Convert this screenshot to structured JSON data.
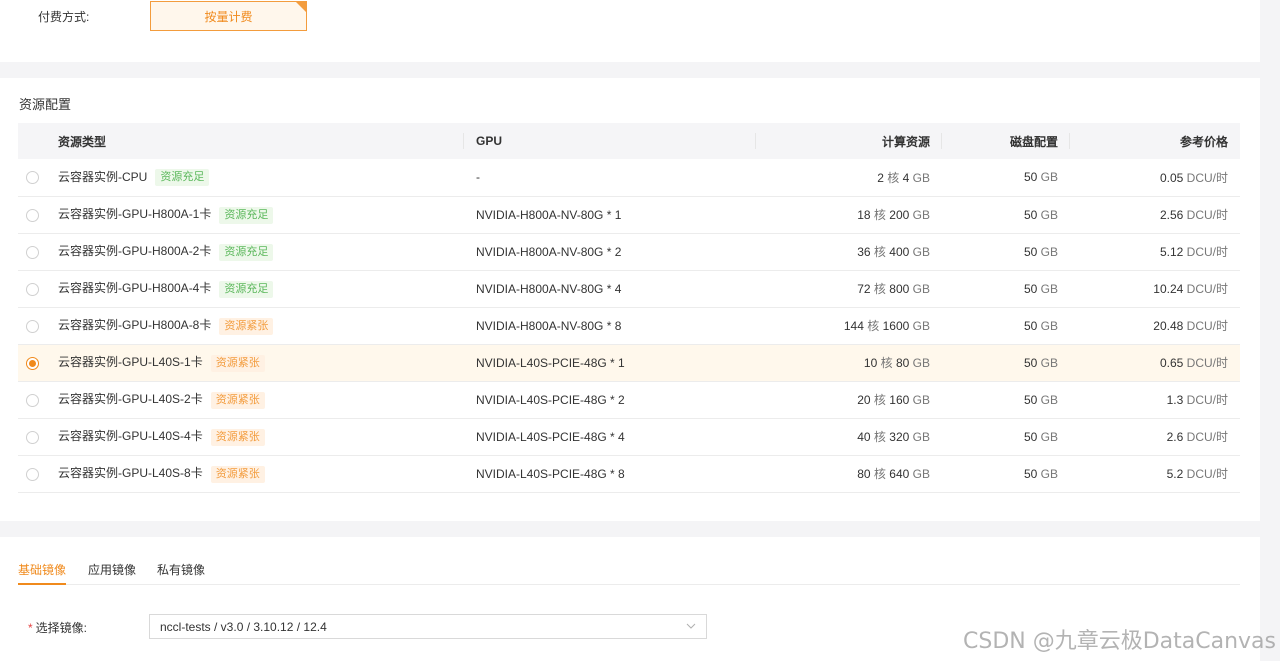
{
  "billing": {
    "label": "付费方式:",
    "option_label": "按量计费"
  },
  "resources": {
    "title": "资源配置",
    "columns": [
      "资源类型",
      "GPU",
      "计算资源",
      "磁盘配置",
      "参考价格"
    ],
    "rows": [
      {
        "name": "云容器实例-CPU",
        "tag": "资源充足",
        "tag_type": "ok",
        "gpu": "-",
        "cores": "2",
        "core_unit": "核",
        "mem": "4",
        "mem_unit": "GB",
        "disk": "50",
        "disk_unit": "GB",
        "price": "0.05",
        "price_unit": "DCU/时",
        "selected": false
      },
      {
        "name": "云容器实例-GPU-H800A-1卡",
        "tag": "资源充足",
        "tag_type": "ok",
        "gpu": "NVIDIA-H800A-NV-80G * 1",
        "cores": "18",
        "core_unit": "核",
        "mem": "200",
        "mem_unit": "GB",
        "disk": "50",
        "disk_unit": "GB",
        "price": "2.56",
        "price_unit": "DCU/时",
        "selected": false
      },
      {
        "name": "云容器实例-GPU-H800A-2卡",
        "tag": "资源充足",
        "tag_type": "ok",
        "gpu": "NVIDIA-H800A-NV-80G * 2",
        "cores": "36",
        "core_unit": "核",
        "mem": "400",
        "mem_unit": "GB",
        "disk": "50",
        "disk_unit": "GB",
        "price": "5.12",
        "price_unit": "DCU/时",
        "selected": false
      },
      {
        "name": "云容器实例-GPU-H800A-4卡",
        "tag": "资源充足",
        "tag_type": "ok",
        "gpu": "NVIDIA-H800A-NV-80G * 4",
        "cores": "72",
        "core_unit": "核",
        "mem": "800",
        "mem_unit": "GB",
        "disk": "50",
        "disk_unit": "GB",
        "price": "10.24",
        "price_unit": "DCU/时",
        "selected": false
      },
      {
        "name": "云容器实例-GPU-H800A-8卡",
        "tag": "资源紧张",
        "tag_type": "tight",
        "gpu": "NVIDIA-H800A-NV-80G * 8",
        "cores": "144",
        "core_unit": "核",
        "mem": "1600",
        "mem_unit": "GB",
        "disk": "50",
        "disk_unit": "GB",
        "price": "20.48",
        "price_unit": "DCU/时",
        "selected": false
      },
      {
        "name": "云容器实例-GPU-L40S-1卡",
        "tag": "资源紧张",
        "tag_type": "tight",
        "gpu": "NVIDIA-L40S-PCIE-48G * 1",
        "cores": "10",
        "core_unit": "核",
        "mem": "80",
        "mem_unit": "GB",
        "disk": "50",
        "disk_unit": "GB",
        "price": "0.65",
        "price_unit": "DCU/时",
        "selected": true
      },
      {
        "name": "云容器实例-GPU-L40S-2卡",
        "tag": "资源紧张",
        "tag_type": "tight",
        "gpu": "NVIDIA-L40S-PCIE-48G * 2",
        "cores": "20",
        "core_unit": "核",
        "mem": "160",
        "mem_unit": "GB",
        "disk": "50",
        "disk_unit": "GB",
        "price": "1.3",
        "price_unit": "DCU/时",
        "selected": false
      },
      {
        "name": "云容器实例-GPU-L40S-4卡",
        "tag": "资源紧张",
        "tag_type": "tight",
        "gpu": "NVIDIA-L40S-PCIE-48G * 4",
        "cores": "40",
        "core_unit": "核",
        "mem": "320",
        "mem_unit": "GB",
        "disk": "50",
        "disk_unit": "GB",
        "price": "2.6",
        "price_unit": "DCU/时",
        "selected": false
      },
      {
        "name": "云容器实例-GPU-L40S-8卡",
        "tag": "资源紧张",
        "tag_type": "tight",
        "gpu": "NVIDIA-L40S-PCIE-48G * 8",
        "cores": "80",
        "core_unit": "核",
        "mem": "640",
        "mem_unit": "GB",
        "disk": "50",
        "disk_unit": "GB",
        "price": "5.2",
        "price_unit": "DCU/时",
        "selected": false
      }
    ]
  },
  "images": {
    "tabs": [
      "基础镜像",
      "应用镜像",
      "私有镜像"
    ],
    "active_tab": 0,
    "field_required_mark": "*",
    "field_label": "选择镜像:",
    "selected_value": "nccl-tests / v3.0 / 3.10.12 / 12.4"
  },
  "watermark": "CSDN @九章云极DataCanvas",
  "colors": {
    "accent": "#f08a1c",
    "tag_ok": "#5cb85c",
    "tag_tight": "#f39c3d",
    "selected_row_bg": "#fff8ec"
  }
}
